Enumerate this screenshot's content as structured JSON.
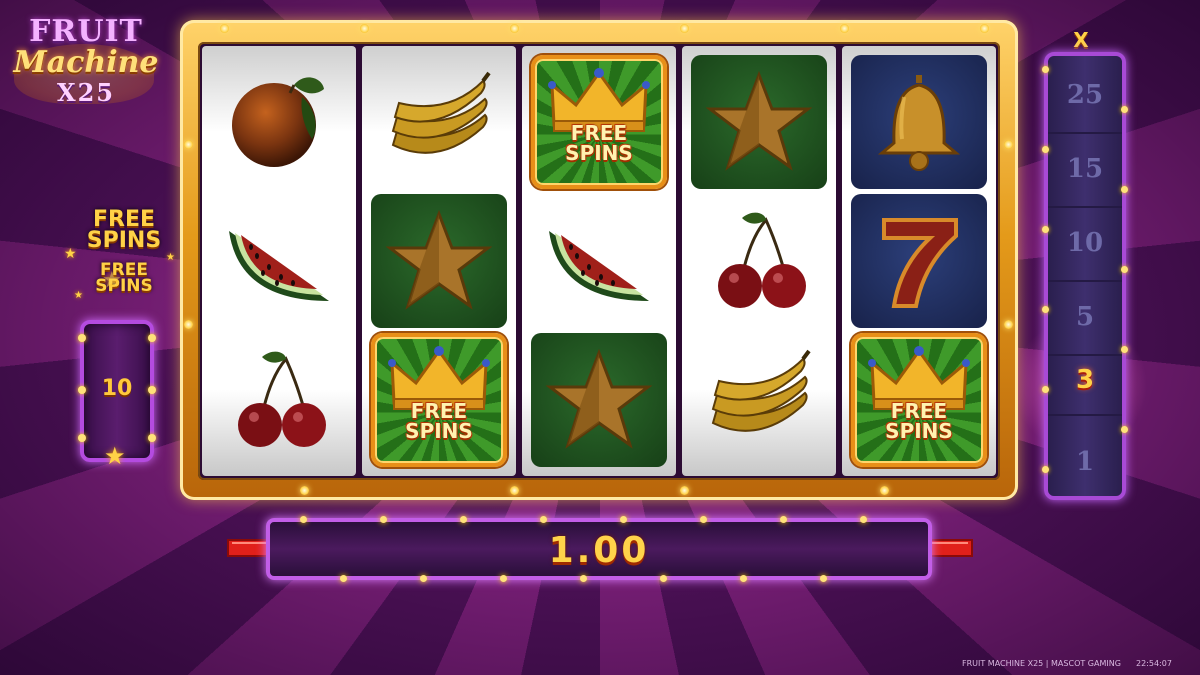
{
  "game": {
    "logo": {
      "line1": "FRUIT",
      "line2": "Machine",
      "line3": "X25"
    },
    "free_spins": {
      "label_top": "FREE SPINS",
      "label_sub": "FREE SPINS",
      "count": "10"
    },
    "multiplier": {
      "header": "X",
      "steps": [
        "25",
        "15",
        "10",
        "5",
        "3",
        "1"
      ],
      "active": "3"
    },
    "win": {
      "value": "1.00"
    },
    "reels": [
      [
        "orange",
        "watermelon",
        "cherry"
      ],
      [
        "banana",
        "star",
        "free-spins"
      ],
      [
        "free-spins",
        "watermelon",
        "star"
      ],
      [
        "star",
        "cherry",
        "banana"
      ],
      [
        "bell",
        "seven",
        "free-spins"
      ]
    ],
    "free_spins_symbol_text": "FREE SPINS"
  },
  "footer": {
    "title": "FRUIT MACHINE X25 | MASCOT GAMING",
    "clock": "22:54:07"
  },
  "colors": {
    "background_primary": "#7a1f78",
    "background_secondary": "#4d1157",
    "frame_gold": "#e49a1a",
    "neon_purple": "#c25ee8",
    "win_text": "#ffd34a",
    "arrow_red": "#e0201a"
  }
}
